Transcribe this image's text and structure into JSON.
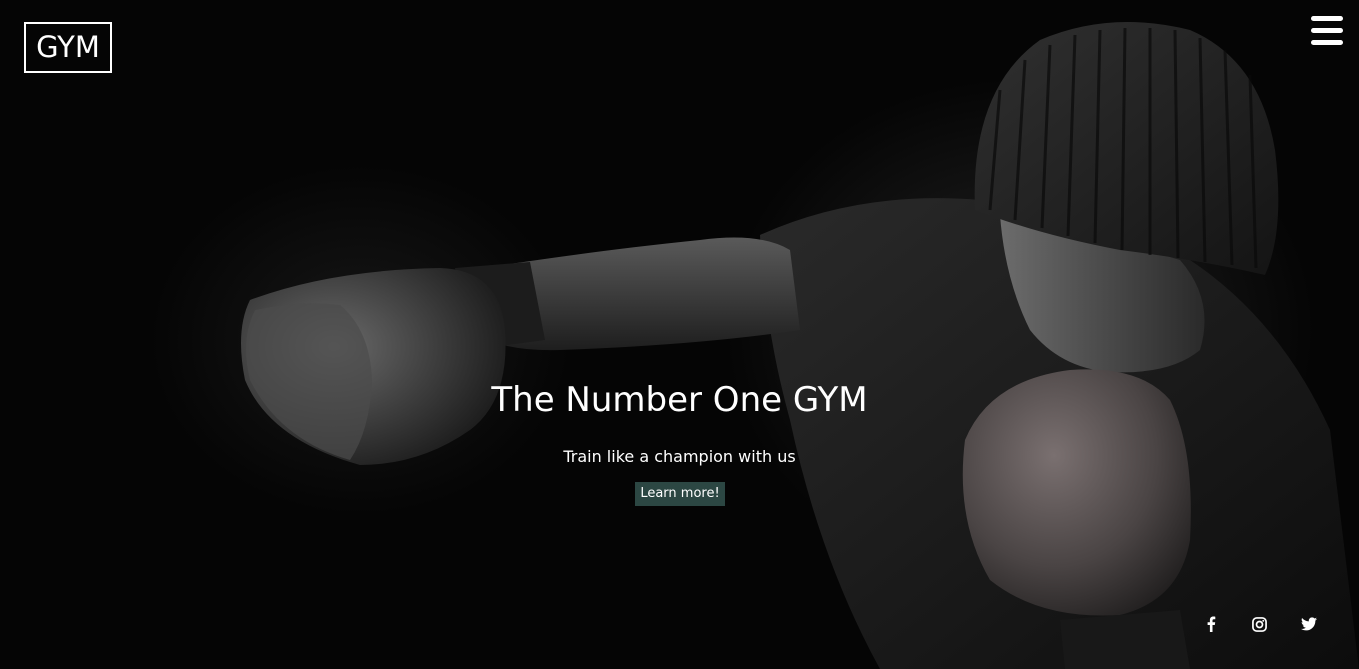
{
  "brand": {
    "logo_text": "GYM"
  },
  "header": {
    "menu_icon": "hamburger-menu-icon"
  },
  "hero": {
    "title": "The Number One GYM",
    "subtitle": "Train like a champion with us",
    "cta_label": "Learn more!"
  },
  "social": [
    {
      "icon": "facebook-icon"
    },
    {
      "icon": "instagram-icon"
    },
    {
      "icon": "twitter-icon"
    }
  ],
  "colors": {
    "background": "#000000",
    "cta_background": "#2c4743",
    "text": "#ffffff"
  }
}
